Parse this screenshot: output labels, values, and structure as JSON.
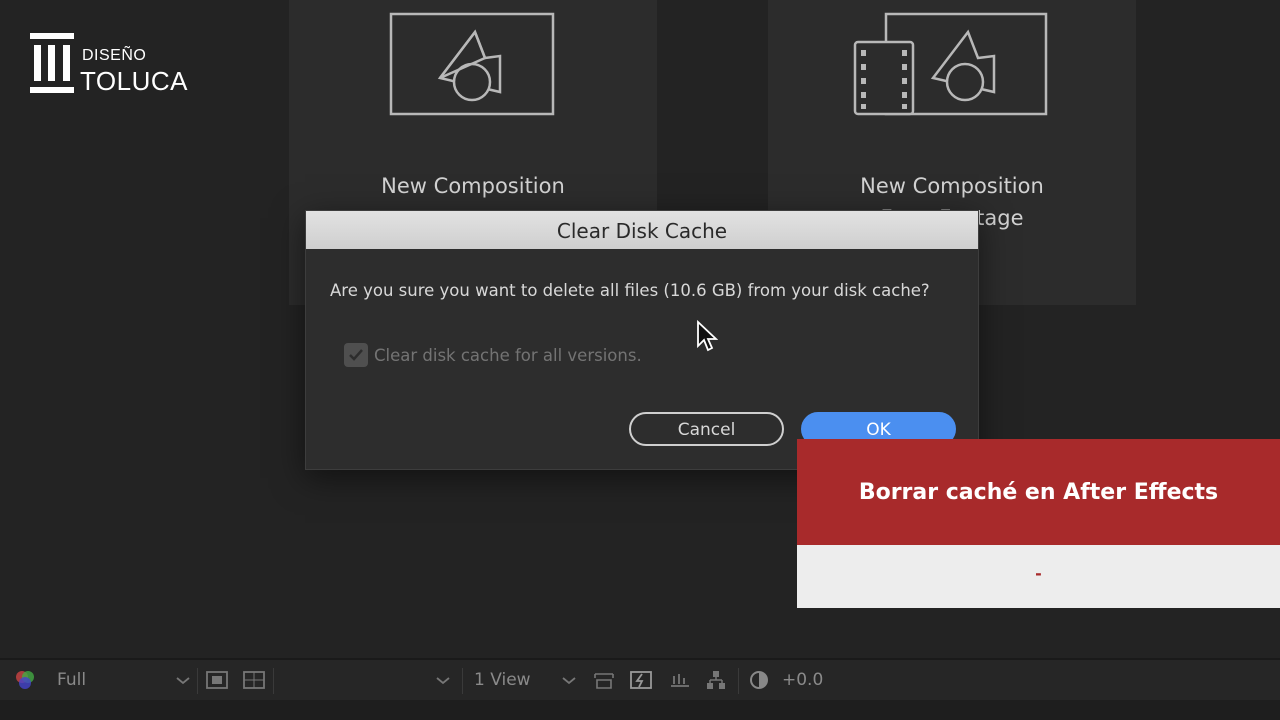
{
  "logo": {
    "line1": "DISEÑO",
    "line2": "TOLUCA"
  },
  "cards": [
    {
      "label": "New Composition"
    },
    {
      "label": "New Composition",
      "label_line2": "From Footage"
    }
  ],
  "dialog": {
    "title": "Clear Disk Cache",
    "message": "Are you sure you want to delete all files (10.6 GB) from your disk cache?",
    "checkbox_label": "Clear disk cache for all versions.",
    "checkbox_checked": true,
    "cancel_label": "Cancel",
    "ok_label": "OK"
  },
  "banner": {
    "title": "Borrar caché en After Effects",
    "subtitle": "-"
  },
  "toolbar": {
    "resolution": "Full",
    "view_layout": "1 View",
    "exposure": "+0.0"
  },
  "colors": {
    "banner_red": "#a82a2b",
    "ok_blue": "#4b8ff0"
  }
}
